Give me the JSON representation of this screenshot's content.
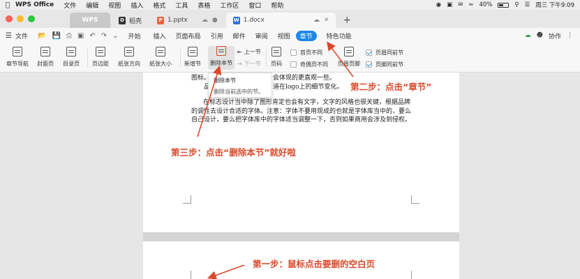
{
  "menubar": {
    "app_name": "WPS Office",
    "items": [
      "文件",
      "编辑",
      "视图",
      "插入",
      "格式",
      "工具",
      "表格",
      "工作区",
      "窗口",
      "帮助"
    ],
    "battery": "40%",
    "datetime": "周三 下午9:09"
  },
  "tabs": {
    "home": "WPS",
    "tab1": "稻壳",
    "tab2": "1.pptx",
    "tab3": "1.docx"
  },
  "ribbon_tabs": {
    "file": "文件",
    "items": [
      "开始",
      "插入",
      "页面布局",
      "引用",
      "邮件",
      "审阅",
      "视图",
      "章节",
      "特色功能"
    ],
    "selected": "章节",
    "collaborate": "协作"
  },
  "toolbar": {
    "chapter_nav": "章节导航",
    "cover": "封面页",
    "toc": "目录页",
    "margins": "页边距",
    "orientation": "纸张方向",
    "size": "纸张大小",
    "new_section": "新增节",
    "delete_section": "删除本节",
    "prev_section": "上一节",
    "next_section": "下一节",
    "page_number": "页码",
    "first_diff": "首页不同",
    "odd_even_diff": "奇偶页不同",
    "header_footer": "页眉页脚",
    "header_same": "页眉同前节",
    "footer_same": "页脚同前节"
  },
  "popup": {
    "title": "删除本节",
    "desc": "删除当前选中的节。"
  },
  "doc": {
    "line1a": "图标。",
    "line1b": "会体现的更直观一些。",
    "line2a": "品",
    "line2b": "道在logo上的细节变化。",
    "para_line1": "在标志设计当中除了图形肯定也会有文字，文字的风格也很关键，根据品牌",
    "para_line2": "的调性去设计合适的字体。注意：字体不要用现成的也就是字体库当中的，要么",
    "para_line3": "自己设计，要么把字体库中的字体适当调整一下，否则如果商用会涉及到侵权。"
  },
  "annotations": {
    "step1": "第一步：鼠标点击要删的空白页",
    "step2": "第二步：点击“章节”",
    "step3": "第三步：点击“删除本节”就好啦"
  },
  "colors": {
    "accent": "#1e88e5",
    "annotation": "#d94a2c"
  }
}
